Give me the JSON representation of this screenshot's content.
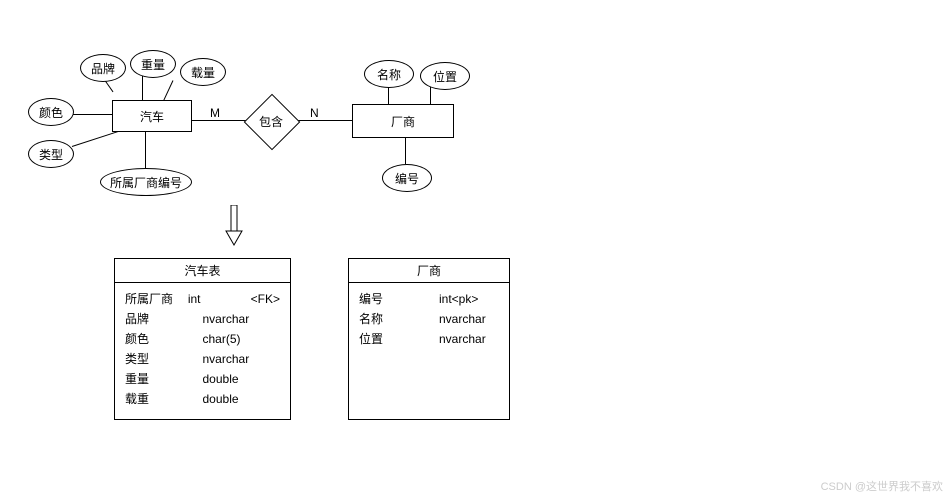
{
  "er": {
    "car_entity": "汽车",
    "vendor_entity": "厂商",
    "relationship": "包含",
    "card_left": "M",
    "card_right": "N",
    "car_attrs": {
      "brand": "品牌",
      "weight": "重量",
      "load": "载量",
      "color": "颜色",
      "type": "类型",
      "vendor_id": "所属厂商编号"
    },
    "vendor_attrs": {
      "name": "名称",
      "location": "位置",
      "id": "编号"
    }
  },
  "tables": {
    "car": {
      "title": "汽车表",
      "rows": [
        {
          "name": "所属厂商",
          "type": "int",
          "note": "<FK>"
        },
        {
          "name": "品牌",
          "type": "nvarchar",
          "note": ""
        },
        {
          "name": "颜色",
          "type": "char(5)",
          "note": ""
        },
        {
          "name": "类型",
          "type": "nvarchar",
          "note": ""
        },
        {
          "name": "重量",
          "type": "double",
          "note": ""
        },
        {
          "name": "载重",
          "type": "double",
          "note": ""
        }
      ]
    },
    "vendor": {
      "title": "厂商",
      "rows": [
        {
          "name": "编号",
          "type": "int<pk>",
          "note": ""
        },
        {
          "name": "名称",
          "type": "nvarchar",
          "note": ""
        },
        {
          "name": "位置",
          "type": "nvarchar",
          "note": ""
        }
      ]
    }
  },
  "watermark": "CSDN @这世界我不喜欢"
}
